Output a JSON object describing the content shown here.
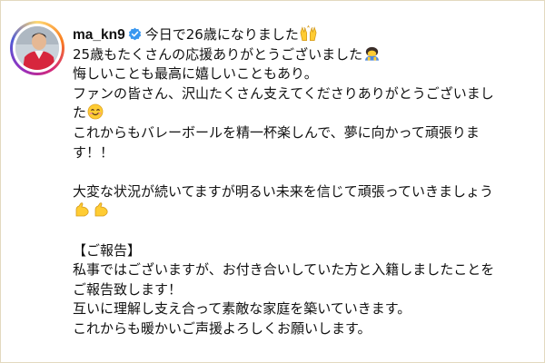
{
  "post": {
    "username": "ma_kn9",
    "headline": "今日で26歳になりました",
    "headline_emoji_icon": "raised-hands-icon",
    "lines": [
      {
        "text": "25歳もたくさんの応援ありがとうございました",
        "emoji": "bowing-person-icon"
      },
      {
        "text": "悔しいことも最高に嬉しいこともあり。"
      },
      {
        "text": "ファンの皆さん、沢山たくさん支えてくださりありがとうございまし"
      },
      {
        "text": "た",
        "emoji": "smiling-face-icon"
      },
      {
        "text": "これからもバレーボールを精一杯楽しんで、夢に向かって頑張りま"
      },
      {
        "text": "す！！"
      },
      {
        "text": ""
      },
      {
        "text": "大変な状況が続いてますが明るい未来を信じて頑張っていきましょう"
      },
      {
        "text": "",
        "emoji": "flexed-biceps-icon-pair"
      },
      {
        "text": ""
      },
      {
        "text": "【ご報告】"
      },
      {
        "text": "私事ではございますが、お付き合いしていた方と入籍しましたことを"
      },
      {
        "text": "ご報告致します！"
      },
      {
        "text": "互いに理解し支え合って素敵な家庭を築いていきます。"
      },
      {
        "text": "これからも暖かいご声援よろしくお願いします。"
      }
    ]
  },
  "colors": {
    "background": "#f4ecd8",
    "text": "#111111",
    "verified_badge": "#3897f0",
    "emoji_yellow": "#ffcc33"
  },
  "icons": {
    "verified": "verified-badge-icon",
    "avatar": "profile-avatar"
  }
}
